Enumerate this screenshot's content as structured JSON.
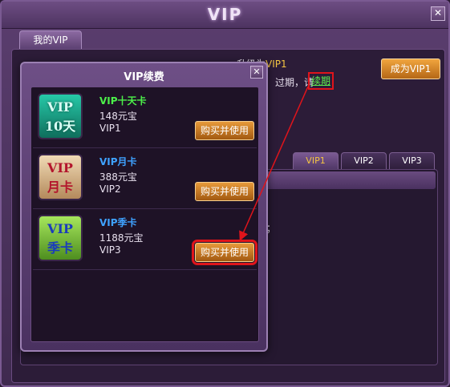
{
  "window": {
    "title": "VIP",
    "close_glyph": "✕"
  },
  "tabs": {
    "my_vip": "我的VIP"
  },
  "info": {
    "upgrade_prefix": "升级为",
    "upgrade_vip": "VIP1",
    "expire_text": "过期，请",
    "renew_link": "续期"
  },
  "become_vip_button": "成为VIP1",
  "vip_tabs": [
    {
      "label": "VIP1",
      "active": true
    },
    {
      "label": "VIP2",
      "active": false
    },
    {
      "label": "VIP3",
      "active": false
    }
  ],
  "content_partial_text": "）；",
  "dialog": {
    "title": "VIP续费",
    "close_glyph": "✕",
    "cards": [
      {
        "icon_text": "VIP\n10天",
        "name": "VIP十天卡",
        "name_color": "#4cf04a",
        "price": "148元宝",
        "level": "VIP1",
        "button": "购买并使用",
        "highlighted": false
      },
      {
        "icon_text": "VIP\n月卡",
        "name": "VIP月卡",
        "name_color": "#3fa2ff",
        "price": "388元宝",
        "level": "VIP2",
        "button": "购买并使用",
        "highlighted": false
      },
      {
        "icon_text": "VIP\n季卡",
        "name": "VIP季卡",
        "name_color": "#3fa2ff",
        "price": "1188元宝",
        "level": "VIP3",
        "button": "购买并使用",
        "highlighted": true
      }
    ]
  },
  "colors": {
    "accent_red": "#e0141b",
    "gold": "#f4c542",
    "green_link": "#5ef04e"
  }
}
